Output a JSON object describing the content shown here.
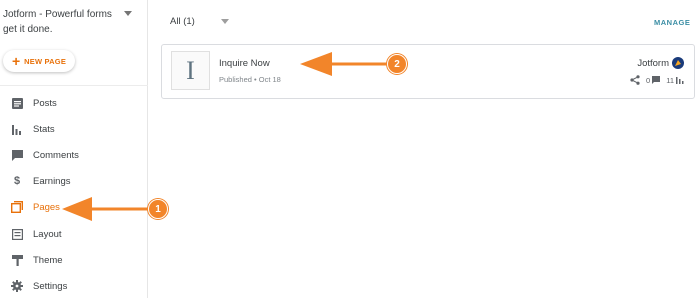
{
  "sidebar": {
    "blog_title": "Jotform - Powerful forms get it done.",
    "new_page_label": "NEW PAGE",
    "items": [
      {
        "label": "Posts",
        "icon": "posts-icon",
        "active": false
      },
      {
        "label": "Stats",
        "icon": "stats-icon",
        "active": false
      },
      {
        "label": "Comments",
        "icon": "comments-icon",
        "active": false
      },
      {
        "label": "Earnings",
        "icon": "dollar-icon",
        "active": false
      },
      {
        "label": "Pages",
        "icon": "pages-icon",
        "active": true
      },
      {
        "label": "Layout",
        "icon": "layout-icon",
        "active": false
      },
      {
        "label": "Theme",
        "icon": "theme-icon",
        "active": false
      },
      {
        "label": "Settings",
        "icon": "gear-icon",
        "active": false
      }
    ]
  },
  "main": {
    "filter_value": "All (1)",
    "manage_label": "MANAGE",
    "page": {
      "thumb_letter": "I",
      "title": "Inquire Now",
      "meta": "Published • Oct 18",
      "author": "Jotform",
      "comments": "0",
      "views": "11"
    }
  },
  "annotations": {
    "badge1": "1",
    "badge2": "2"
  },
  "colors": {
    "accent": "#e8710a",
    "annotation": "#f2852a",
    "manage": "#3b8ea5"
  }
}
